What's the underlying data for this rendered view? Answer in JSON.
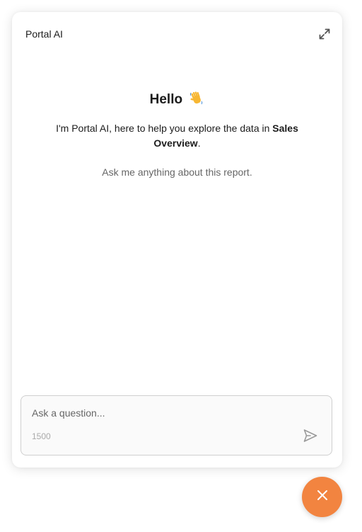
{
  "header": {
    "title": "Portal AI",
    "expand_icon": "expand-arrows-icon"
  },
  "welcome": {
    "greeting": "Hello",
    "greeting_emoji": "👋",
    "intro_prefix": "I'm Portal AI, here to help you explore the data in ",
    "report_name": "Sales Overview",
    "intro_suffix": ".",
    "hint": "Ask me anything about this report."
  },
  "composer": {
    "placeholder": "Ask a question...",
    "value": "",
    "char_limit": "1500",
    "send_icon": "send-icon"
  },
  "fab": {
    "icon": "close-icon",
    "color": "#f28440"
  }
}
